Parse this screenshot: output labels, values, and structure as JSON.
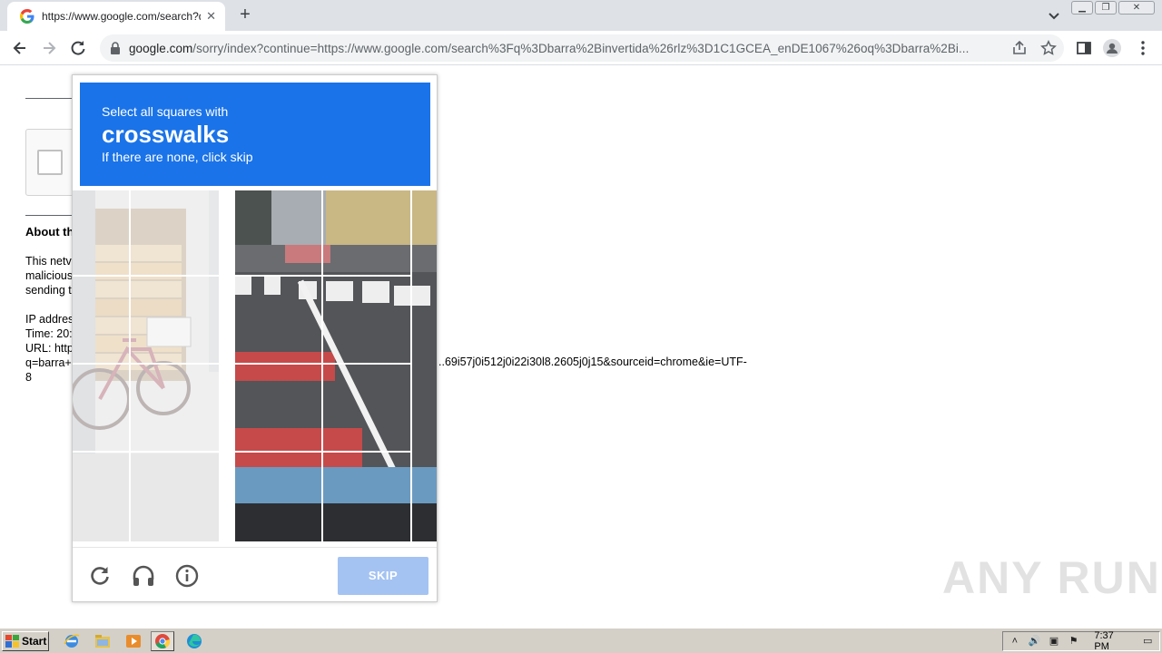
{
  "browser": {
    "tab_title": "https://www.google.com/search?q=",
    "new_tab_label": "+",
    "url_host": "google.com",
    "url_path": "/sorry/index?continue=https://www.google.com/search%3Fq%3Dbarra%2Binvertida%26rlz%3D1C1GCEA_enDE1067%26oq%3Dbarra%2Bi..."
  },
  "page": {
    "about_title": "About th",
    "para1": [
      "This netv",
      "malicious",
      "sending t"
    ],
    "para2": [
      "IP addres",
      "Time: 20:",
      "URL: http",
      "q=barra+",
      "8"
    ],
    "url_tail": "..69i57j0i512j0i22i30l8.2605j0j15&sourceid=chrome&ie=UTF-"
  },
  "captcha": {
    "instruction_line1": "Select all squares with",
    "target_object": "crosswalks",
    "instruction_line3": "If there are none, click skip",
    "skip_label": "SKIP",
    "icons": [
      "reload-icon",
      "audio-headphones-icon",
      "info-icon"
    ],
    "accent_color": "#1a73e8",
    "skip_color": "#a4c3f2"
  },
  "watermark": "ANY RUN",
  "taskbar": {
    "start_label": "Start",
    "clock": "7:37 PM",
    "apps": [
      "ie-icon",
      "explorer-icon",
      "media-player-icon",
      "chrome-icon",
      "edge-icon"
    ]
  }
}
